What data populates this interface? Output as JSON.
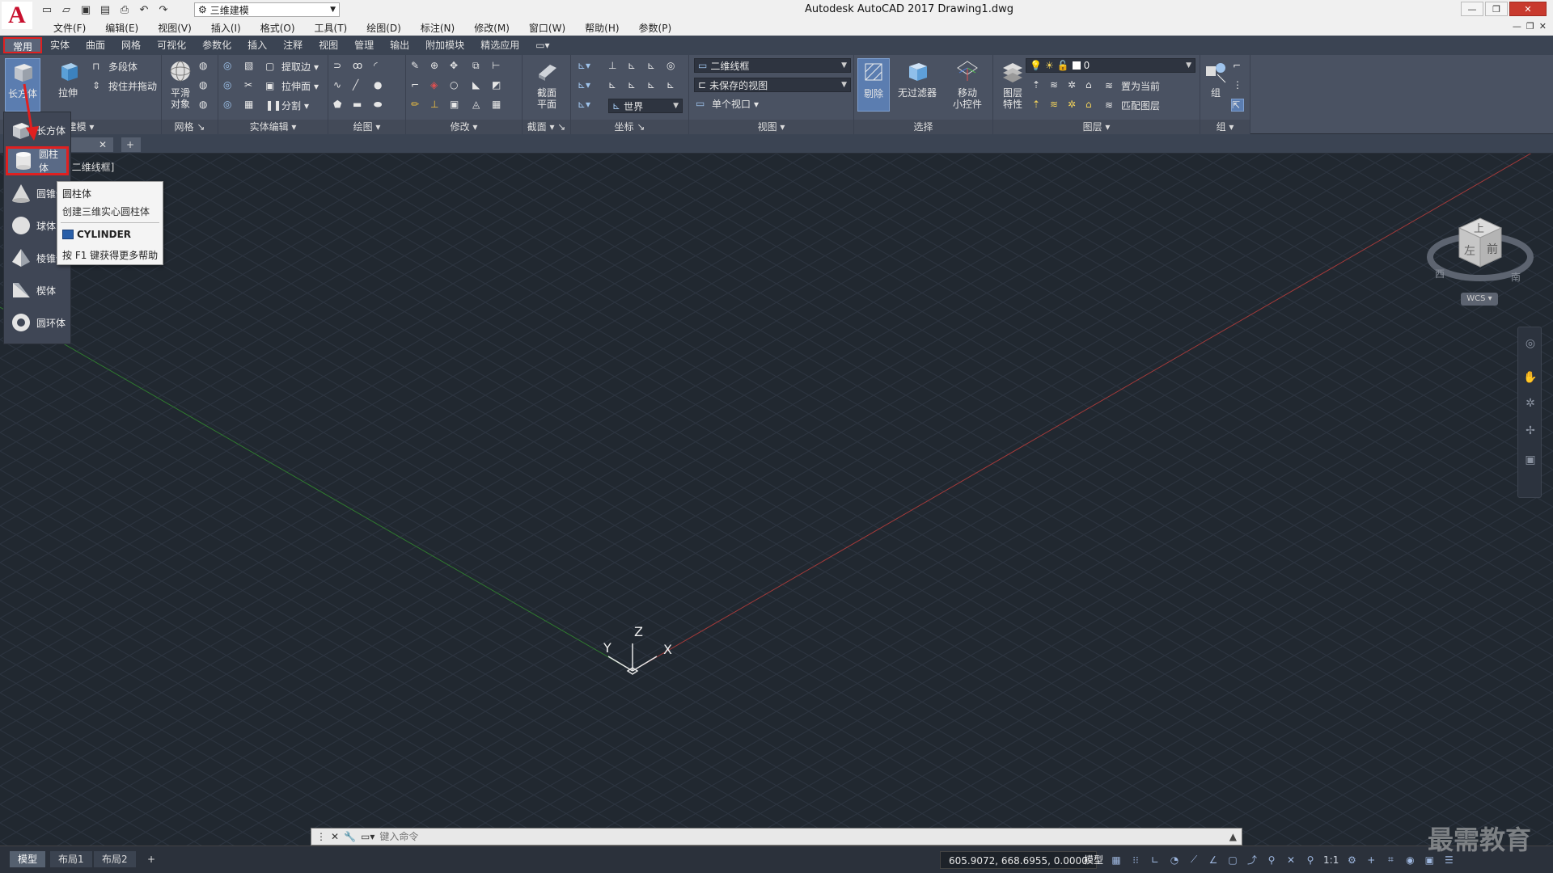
{
  "app": {
    "window_title": "Autodesk AutoCAD 2017    Drawing1.dwg",
    "logo": "A",
    "workspace": "三维建模"
  },
  "menu": [
    "文件(F)",
    "编辑(E)",
    "视图(V)",
    "插入(I)",
    "格式(O)",
    "工具(T)",
    "绘图(D)",
    "标注(N)",
    "修改(M)",
    "窗口(W)",
    "帮助(H)",
    "参数(P)"
  ],
  "ribbon_tabs": [
    "常用",
    "实体",
    "曲面",
    "网格",
    "可视化",
    "参数化",
    "插入",
    "注释",
    "视图",
    "管理",
    "输出",
    "附加模块",
    "精选应用"
  ],
  "ribbon": {
    "modeling": {
      "box": "长方体",
      "extrude": "拉伸",
      "polysolid": "多段体",
      "presspull": "按住并拖动",
      "label": "建模"
    },
    "mesh": {
      "smooth_line1": "平滑",
      "smooth_line2": "对象",
      "label": "网格"
    },
    "solid_edit": {
      "extract_edges": "提取边",
      "extrude_faces": "拉伸面",
      "separate": "分割",
      "label": "实体编辑"
    },
    "draw": {
      "label": "绘图"
    },
    "modify": {
      "label": "修改"
    },
    "section": {
      "plane_line1": "截面",
      "plane_line2": "平面",
      "label": "截面"
    },
    "coordinates": {
      "ucs": "世界",
      "label": "坐标"
    },
    "view": {
      "visual_style": "二维线框",
      "saved_view": "未保存的视图",
      "viewport": "单个视口",
      "label": "视图"
    },
    "selection": {
      "culling": "剔除",
      "no_filter": "无过滤器",
      "gizmo_line1": "移动",
      "gizmo_line2": "小控件",
      "label": "选择"
    },
    "layers": {
      "props_line1": "图层",
      "props_line2": "特性",
      "current_layer": "0",
      "set_current": "置为当前",
      "match": "匹配图层",
      "label": "图层"
    },
    "groups": {
      "group": "组",
      "label": "组"
    }
  },
  "viewport": {
    "label": "[二维线框]",
    "wcs": "WCS",
    "ucs_labels": {
      "x": "X",
      "y": "Y",
      "z": "Z"
    },
    "viewcube": {
      "top": "上",
      "front": "前",
      "left": "左",
      "south": "南",
      "west": "西"
    }
  },
  "gallery": [
    {
      "label": "长方体",
      "icon": "box-icon"
    },
    {
      "label": "圆柱体",
      "icon": "cylinder-icon",
      "selected": true
    },
    {
      "label": "圆锥体",
      "icon": "cone-icon"
    },
    {
      "label": "球体",
      "icon": "sphere-icon"
    },
    {
      "label": "棱锥体",
      "icon": "pyramid-icon"
    },
    {
      "label": "楔体",
      "icon": "wedge-icon"
    },
    {
      "label": "圆环体",
      "icon": "torus-icon"
    }
  ],
  "tooltip": {
    "title": "圆柱体",
    "description": "创建三维实心圆柱体",
    "command": "CYLINDER",
    "help": "按 F1 键获得更多帮助"
  },
  "command_line": {
    "placeholder": "键入命令"
  },
  "status": {
    "layouts": [
      "模型",
      "布局1",
      "布局2"
    ],
    "coords": "605.9072, 668.6955, 0.0000",
    "model": "模型",
    "scale": "1:1"
  },
  "watermark": "最需教育",
  "colors": {
    "accent": "#e02020",
    "viewport_bg": "#212830",
    "ribbon_bg": "#4a5262",
    "axis_x": "#b03030",
    "axis_y": "#2f8a2f"
  }
}
